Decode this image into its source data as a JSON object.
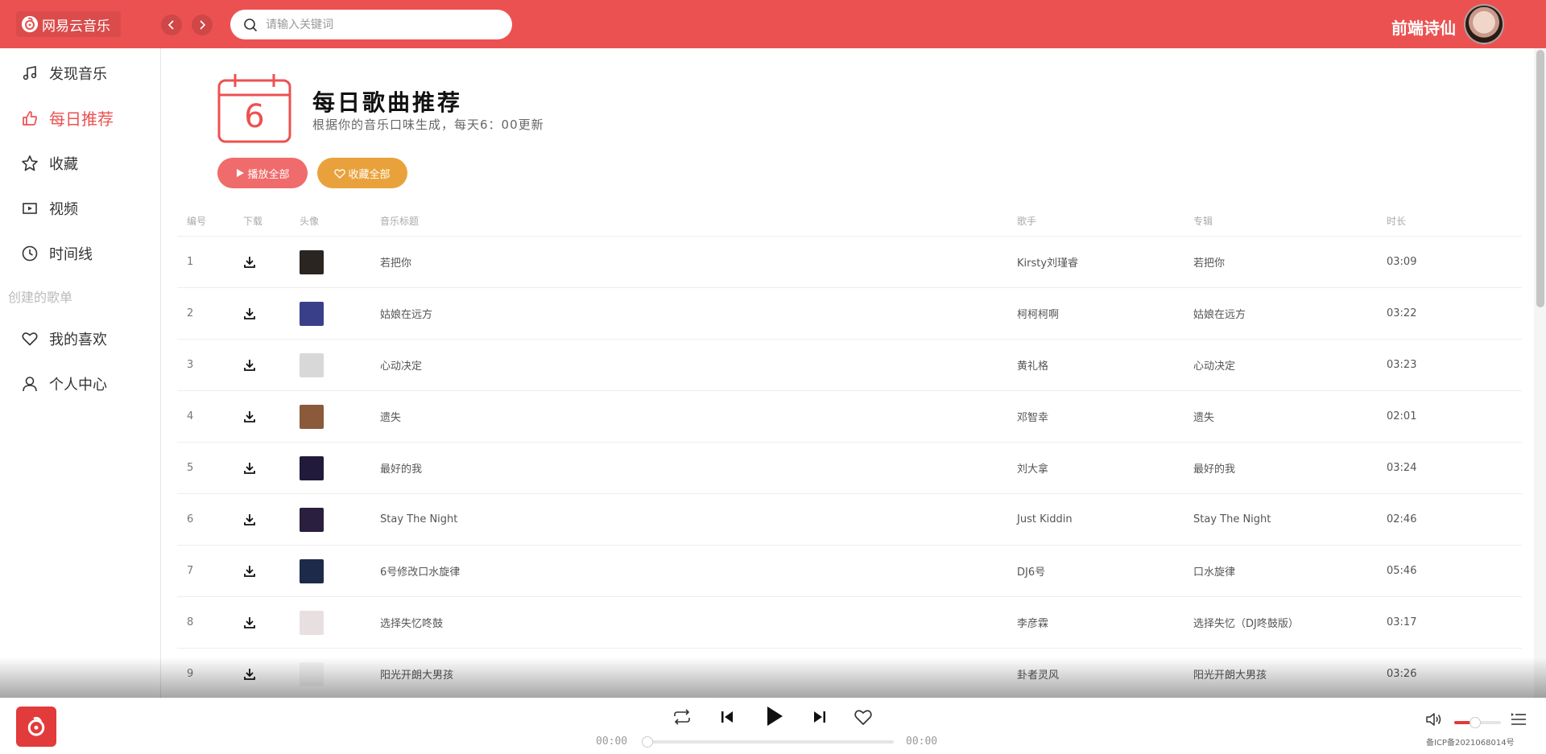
{
  "header": {
    "brand": "网易云音乐",
    "search_placeholder": "请输入关键词",
    "username": "前端诗仙",
    "accent_color": "#ec5151"
  },
  "sidebar": {
    "items": [
      {
        "label": "发现音乐",
        "icon": "music-note-icon",
        "active": false
      },
      {
        "label": "每日推荐",
        "icon": "thumbs-up-icon",
        "active": true
      },
      {
        "label": "收藏",
        "icon": "star-icon",
        "active": false
      },
      {
        "label": "视频",
        "icon": "video-icon",
        "active": false
      },
      {
        "label": "时间线",
        "icon": "clock-icon",
        "active": false
      }
    ],
    "section_title": "创建的歌单",
    "playlist_items": [
      {
        "label": "我的喜欢",
        "icon": "heart-icon"
      },
      {
        "label": "个人中心",
        "icon": "user-icon"
      }
    ]
  },
  "daily": {
    "calendar_day": "6",
    "title": "每日歌曲推荐",
    "subtitle": "根据你的音乐口味生成，每天6：00更新",
    "play_all": "播放全部",
    "collect_all": "收藏全部"
  },
  "table": {
    "headers": {
      "no": "编号",
      "download": "下载",
      "avatar": "头像",
      "title": "音乐标题",
      "artist": "歌手",
      "album": "专辑",
      "duration": "时长"
    },
    "rows": [
      {
        "no": "1",
        "title": "若把你",
        "artist": "Kirsty刘瑾睿",
        "album": "若把你",
        "duration": "03:09",
        "cover": "#2a2520"
      },
      {
        "no": "2",
        "title": "姑娘在远方",
        "artist": "柯柯柯啊",
        "album": "姑娘在远方",
        "duration": "03:22",
        "cover": "#3a3f8a"
      },
      {
        "no": "3",
        "title": "心动决定",
        "artist": "黄礼格",
        "album": "心动决定",
        "duration": "03:23",
        "cover": "#d8d8d8"
      },
      {
        "no": "4",
        "title": "遗失",
        "artist": "邓智幸",
        "album": "遗失",
        "duration": "02:01",
        "cover": "#8a5a3a"
      },
      {
        "no": "5",
        "title": "最好的我",
        "artist": "刘大拿",
        "album": "最好的我",
        "duration": "03:24",
        "cover": "#221a3a"
      },
      {
        "no": "6",
        "title": "Stay The Night",
        "artist": "Just Kiddin",
        "album": "Stay The Night",
        "duration": "02:46",
        "cover": "#2a1f3f"
      },
      {
        "no": "7",
        "title": "6号修改口水旋律",
        "artist": "DJ6号",
        "album": "口水旋律",
        "duration": "05:46",
        "cover": "#1e2a4a"
      },
      {
        "no": "8",
        "title": "选择失忆咚鼓",
        "artist": "李彦霖",
        "album": "选择失忆（DJ咚鼓版）",
        "duration": "03:17",
        "cover": "#e8e0e0"
      },
      {
        "no": "9",
        "title": "阳光开朗大男孩",
        "artist": "卦者灵风",
        "album": "阳光开朗大男孩",
        "duration": "03:26",
        "cover": "#f4f4f4"
      }
    ]
  },
  "player": {
    "current_time": "00:00",
    "total_time": "00:00",
    "progress": 0,
    "volume": 0.45,
    "icp": "备ICP备2021068014号"
  }
}
